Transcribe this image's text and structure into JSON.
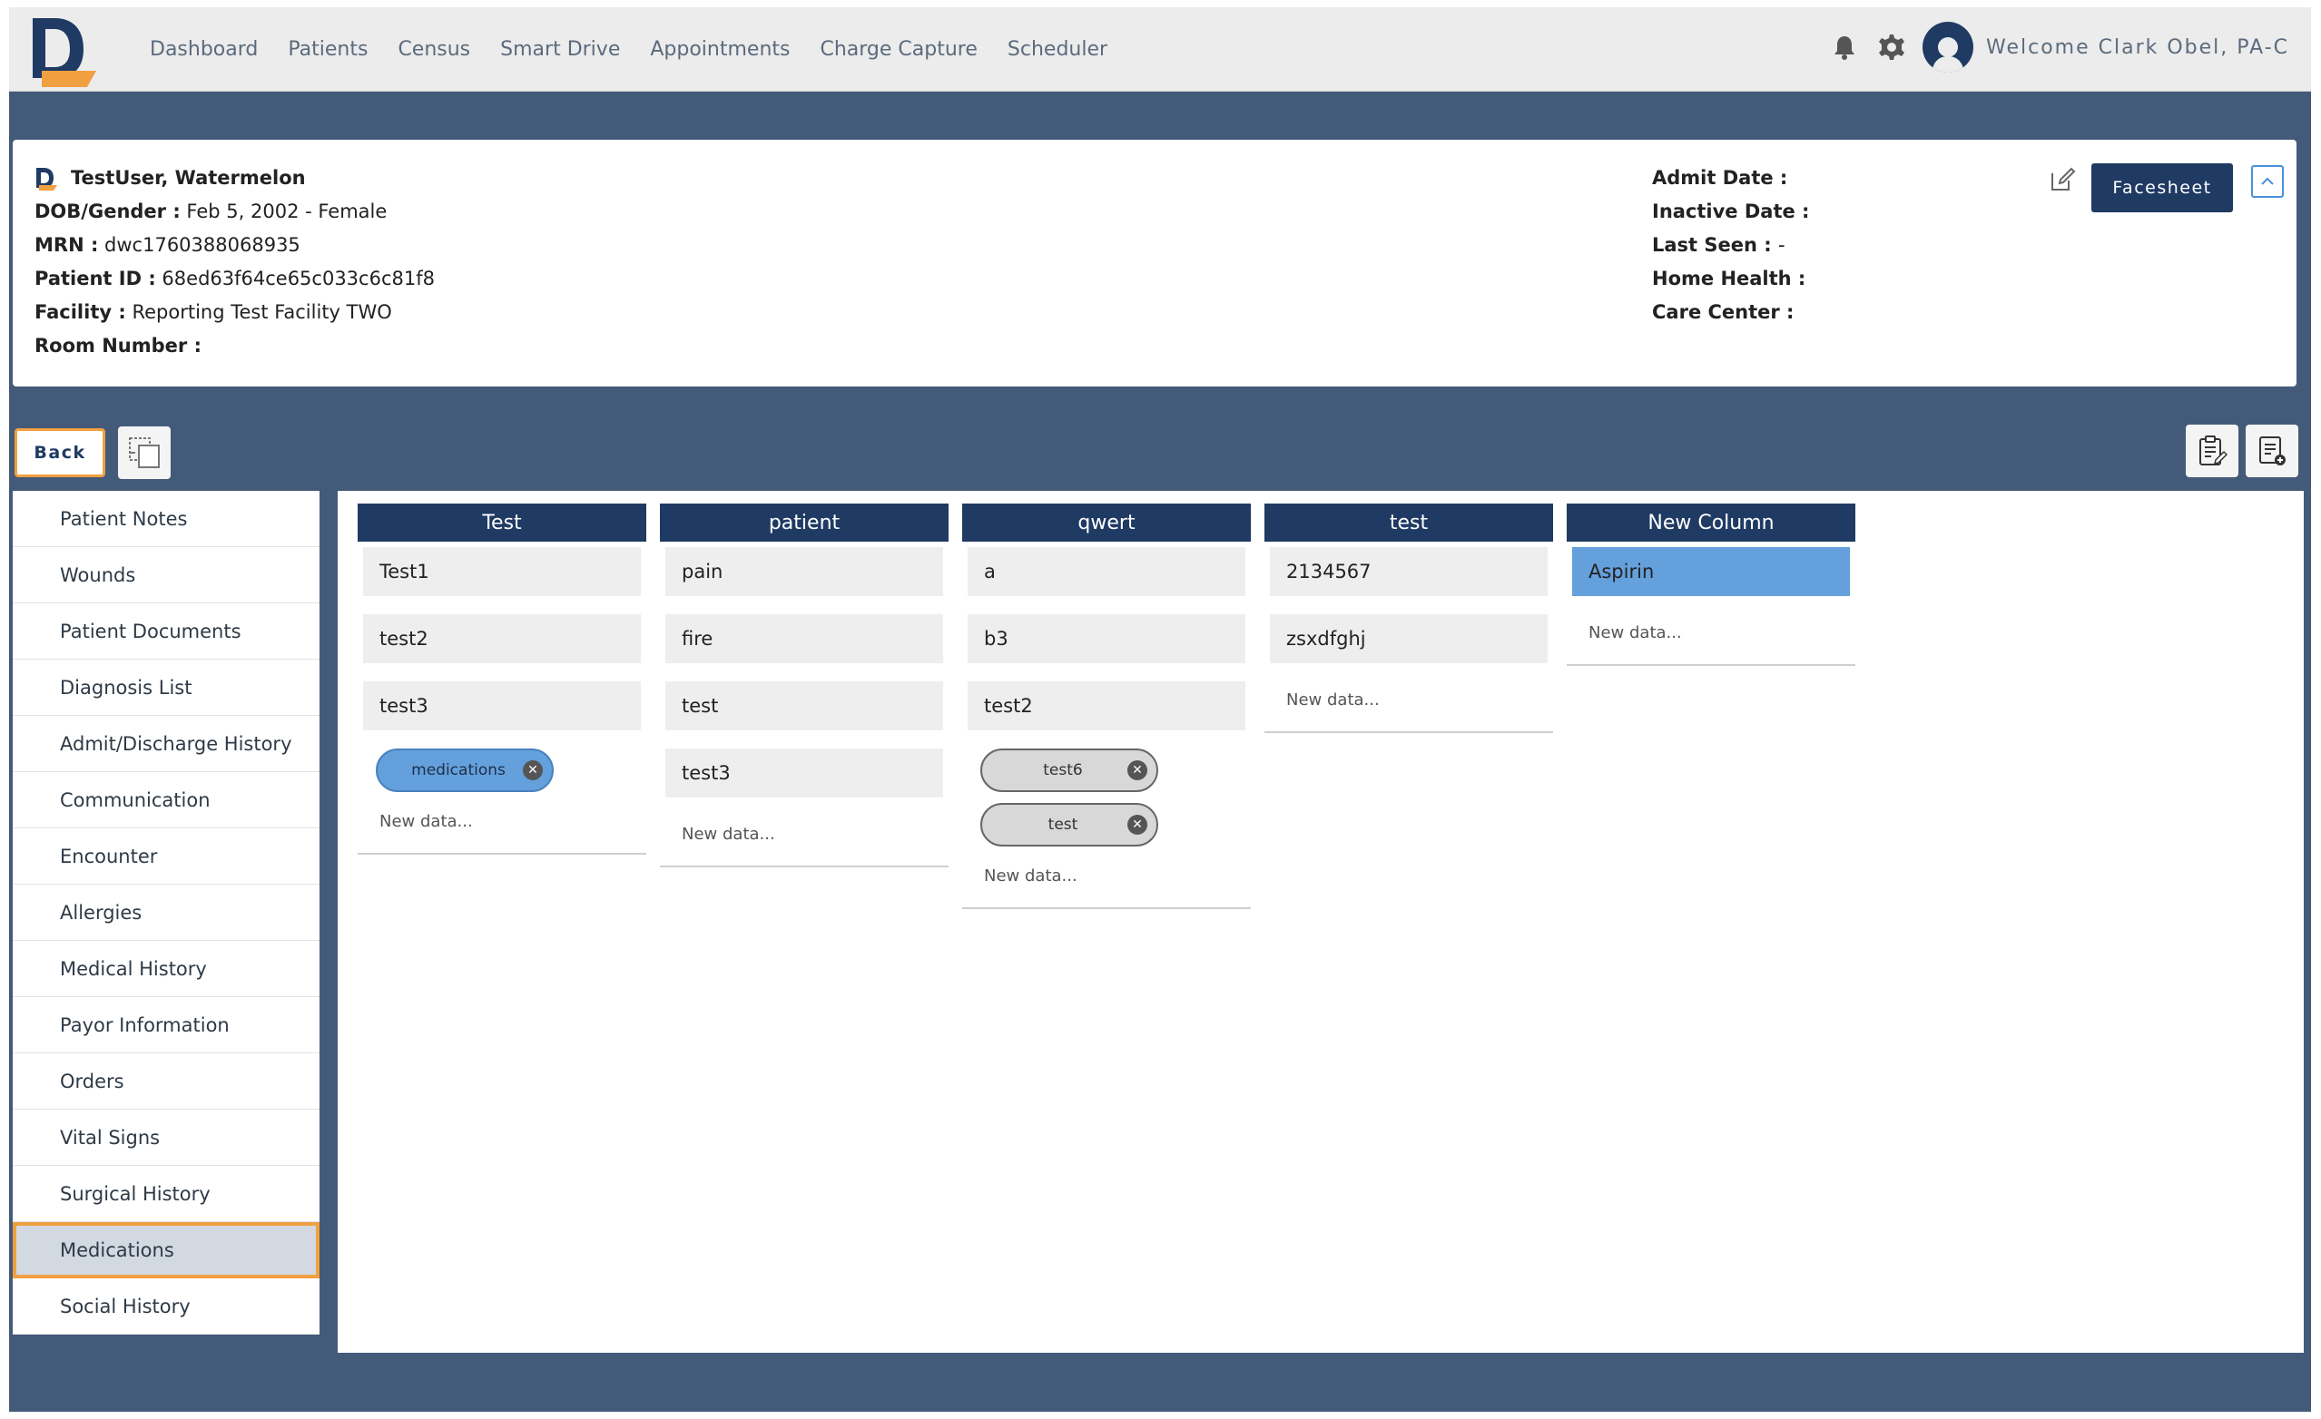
{
  "nav": {
    "items": [
      "Dashboard",
      "Patients",
      "Census",
      "Smart Drive",
      "Appointments",
      "Charge Capture",
      "Scheduler"
    ],
    "welcome": "Welcome Clark Obel, PA-C"
  },
  "patient": {
    "name": "TestUser, Watermelon",
    "dob_gender_label": "DOB/Gender :",
    "dob_gender": "Feb 5, 2002 - Female",
    "mrn_label": "MRN :",
    "mrn": "dwc1760388068935",
    "patient_id_label": "Patient ID :",
    "patient_id": "68ed63f64ce65c033c6c81f8",
    "facility_label": "Facility :",
    "facility": "Reporting Test Facility TWO",
    "room_label": "Room Number :",
    "room": "",
    "admit_date_label": "Admit Date :",
    "inactive_date_label": "Inactive Date :",
    "last_seen_label": "Last Seen :",
    "last_seen": "-",
    "home_health_label": "Home Health :",
    "care_center_label": "Care Center :",
    "facesheet_button": "Facesheet"
  },
  "toolbar": {
    "back_label": "Back"
  },
  "sidebar": {
    "items": [
      {
        "label": "Patient Notes"
      },
      {
        "label": "Wounds"
      },
      {
        "label": "Patient Documents"
      },
      {
        "label": "Diagnosis List"
      },
      {
        "label": "Admit/Discharge History"
      },
      {
        "label": "Communication"
      },
      {
        "label": "Encounter"
      },
      {
        "label": "Allergies"
      },
      {
        "label": "Medical History"
      },
      {
        "label": "Payor Information"
      },
      {
        "label": "Orders"
      },
      {
        "label": "Vital Signs"
      },
      {
        "label": "Surgical History"
      },
      {
        "label": "Medications"
      },
      {
        "label": "Social History"
      }
    ],
    "active": "Medications"
  },
  "board": {
    "new_data_placeholder": "New data...",
    "columns": [
      {
        "title": "Test",
        "cells": [
          "Test1",
          "test2",
          "test3"
        ],
        "chips": [
          "medications"
        ]
      },
      {
        "title": "patient",
        "cells": [
          "pain",
          "fire",
          "test",
          "test3"
        ],
        "chips": []
      },
      {
        "title": "qwert",
        "cells": [
          "a",
          "b3",
          "test2"
        ],
        "chips": [
          "test6",
          "test"
        ]
      },
      {
        "title": "test",
        "cells": [
          "2134567",
          "zsxdfghj"
        ],
        "chips": []
      },
      {
        "title": "New Column",
        "cells": [
          "Aspirin"
        ],
        "chips": []
      }
    ]
  },
  "colors": {
    "primary": "#1f3a63",
    "background": "#445a79",
    "highlight": "#f0a040",
    "selected_cell": "#64a0dc"
  }
}
